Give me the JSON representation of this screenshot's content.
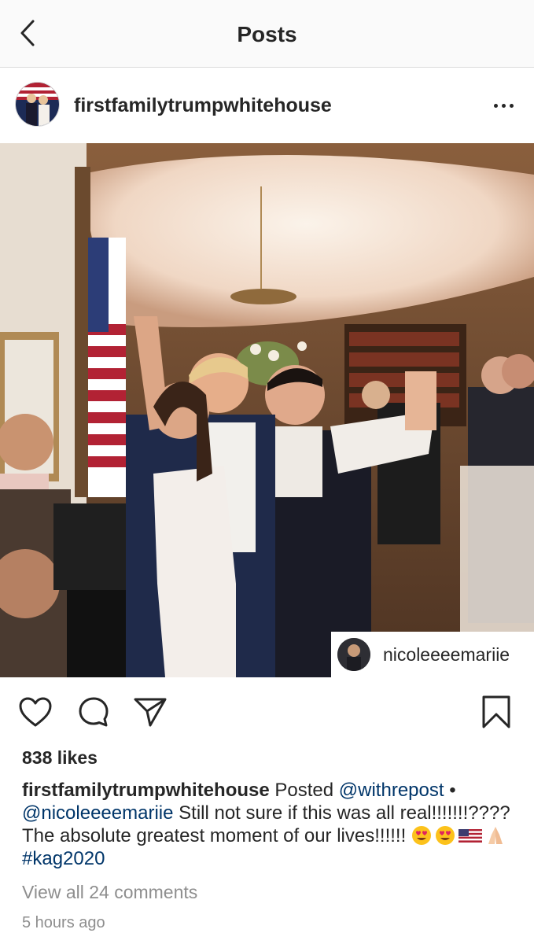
{
  "nav": {
    "title": "Posts",
    "back_icon": "chevron-left-icon"
  },
  "post": {
    "username": "firstfamilytrumpwhitehouse",
    "more_icon": "more-horizontal-icon",
    "repost_credit": "nicoleeeemariie",
    "likes": "838 likes",
    "caption": {
      "username": "firstfamilytrumpwhitehouse",
      "text_before": " Posted ",
      "mention_repost": "@withrepost",
      "bullet": " •",
      "mention_user": "@nicoleeeemariie",
      "text_body": " Still not sure if this was all real!!!!!!!???? The absolute greatest moment of our lives!!!!!! ",
      "emojis": [
        "heart-eyes-emoji",
        "heart-eyes-emoji",
        "us-flag-emoji",
        "folded-hands-emoji"
      ],
      "hashtag": "#kag2020"
    },
    "view_comments": "View all 24 comments",
    "timestamp": "5 hours ago"
  },
  "actions": {
    "like_icon": "heart-icon",
    "comment_icon": "comment-icon",
    "share_icon": "paper-plane-icon",
    "save_icon": "bookmark-icon"
  },
  "colors": {
    "text": "#262626",
    "link": "#003569",
    "muted": "#8e8e8e",
    "nav_bg": "#fafafa",
    "divider": "#dbdbdb"
  }
}
